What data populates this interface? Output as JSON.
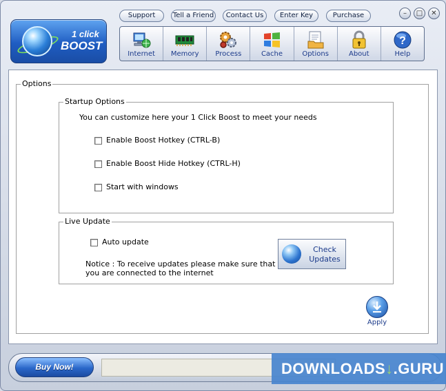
{
  "app": {
    "logo_top": "1 click",
    "logo_bottom": "BOOST"
  },
  "toplinks": [
    "Support",
    "Tell a Friend",
    "Contact Us",
    "Enter Key",
    "Purchase"
  ],
  "window_controls": [
    "minimize-icon",
    "maximize-icon",
    "close-icon"
  ],
  "toolbar": {
    "items": [
      {
        "label": "Internet",
        "icon": "network-computer-icon"
      },
      {
        "label": "Memory",
        "icon": "memory-chip-icon"
      },
      {
        "label": "Process",
        "icon": "gears-icon"
      },
      {
        "label": "Cache",
        "icon": "windows-flag-icon"
      },
      {
        "label": "Options",
        "icon": "options-folder-icon"
      },
      {
        "label": "About",
        "icon": "lock-icon"
      },
      {
        "label": "Help",
        "icon": "help-question-icon"
      }
    ]
  },
  "options_panel": {
    "title": "Options",
    "startup": {
      "title": "Startup Options",
      "description": "You can customize here your 1 Click Boost to meet your needs",
      "checkboxes": [
        {
          "label": "Enable Boost Hotkey (CTRL-B)",
          "checked": false
        },
        {
          "label": "Enable Boost Hide Hotkey (CTRL-H)",
          "checked": false
        },
        {
          "label": "Start with windows",
          "checked": false
        }
      ]
    },
    "live_update": {
      "title": "Live Update",
      "auto_update_label": "Auto update",
      "auto_update_checked": false,
      "notice_line1": "Notice : To receive updates please make sure that",
      "notice_line2": "you are connected to the internet",
      "check_updates_line1": "Check",
      "check_updates_line2": "Updates"
    },
    "apply_label": "Apply"
  },
  "bottom": {
    "buy_now": "Buy Now!",
    "status_text": "",
    "watermark": "DOWNLOADS",
    "watermark_suffix": ".GURU",
    "watermark_arrow": "↓"
  },
  "colors": {
    "accent": "#1f5dc2",
    "link_text": "#1b3a8a",
    "watermark_bg": "#4884ce"
  }
}
